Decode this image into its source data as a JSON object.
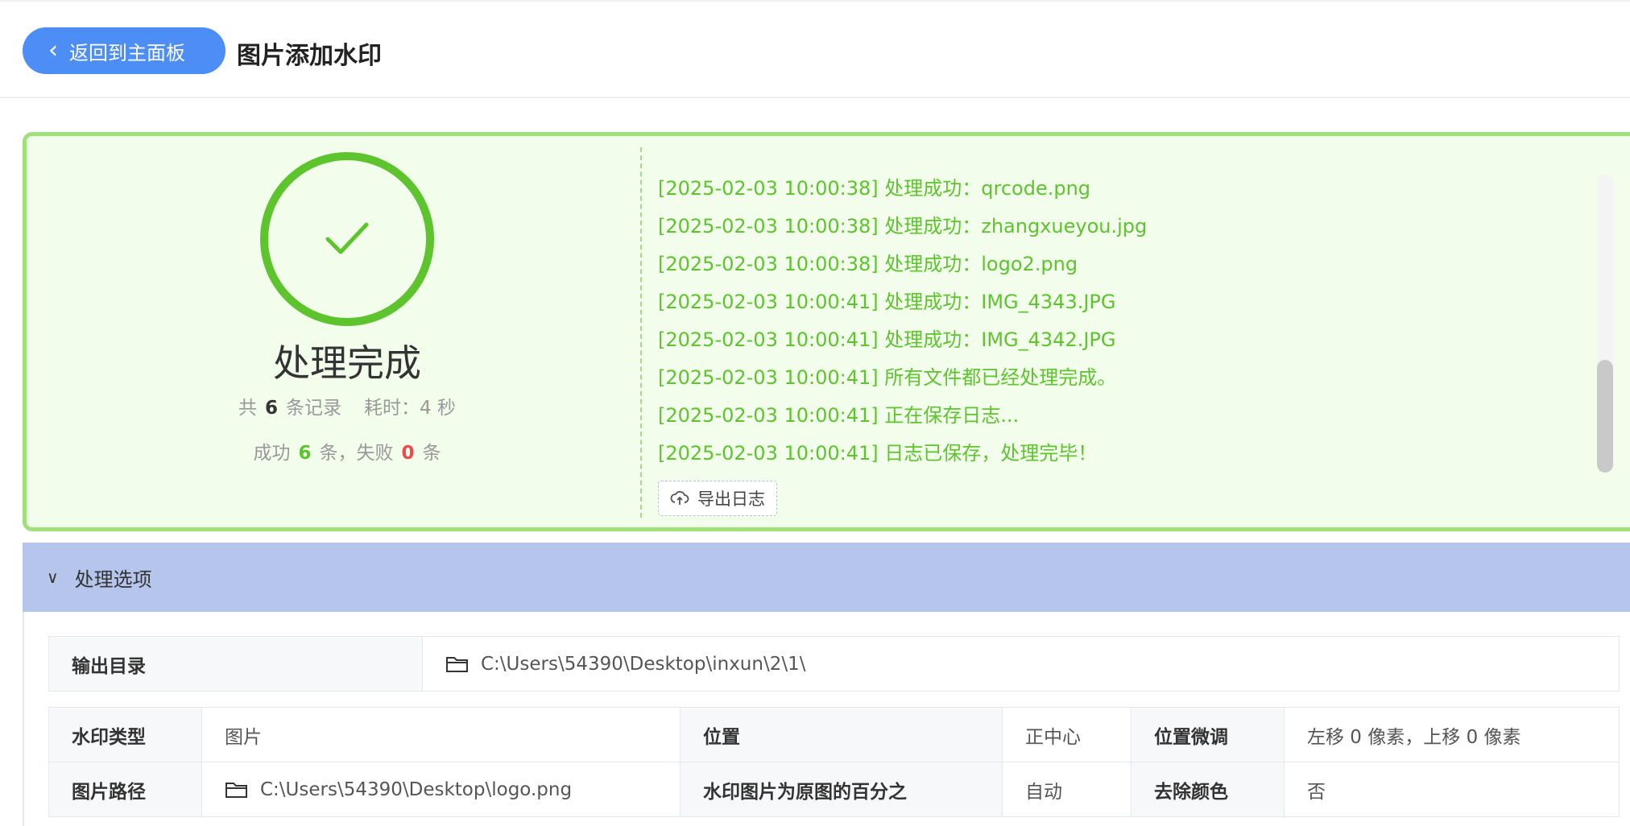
{
  "header": {
    "back_label": "返回到主面板",
    "title": "图片添加水印"
  },
  "result": {
    "status": "处理完成",
    "total_prefix": "共",
    "total_count": "6",
    "total_suffix": "条记录",
    "time_label": "耗时：4 秒",
    "success_prefix": "成功",
    "success_count": "6",
    "success_suffix": "条，失败",
    "fail_count": "0",
    "fail_suffix": "条",
    "export_label": "导出日志"
  },
  "log": [
    "[2025-02-03 10:00:38] 处理成功：qrcode.png",
    "[2025-02-03 10:00:38] 处理成功：zhangxueyou.jpg",
    "[2025-02-03 10:00:38] 处理成功：logo2.png",
    "[2025-02-03 10:00:41] 处理成功：IMG_4343.JPG",
    "[2025-02-03 10:00:41] 处理成功：IMG_4342.JPG",
    "[2025-02-03 10:00:41] 所有文件都已经处理完成。",
    "[2025-02-03 10:00:41] 正在保存日志...",
    "[2025-02-03 10:00:41] 日志已保存，处理完毕！"
  ],
  "options": {
    "title": "处理选项",
    "output_dir_label": "输出目录",
    "output_dir_value": "C:\\Users\\54390\\Desktop\\inxun\\2\\1\\",
    "rows": [
      [
        {
          "label": "水印类型",
          "value": "图片"
        },
        {
          "label": "位置",
          "value": "正中心"
        },
        {
          "label": "位置微调",
          "value": "左移 0 像素，上移 0 像素"
        }
      ],
      [
        {
          "label": "图片路径",
          "value": "C:\\Users\\54390\\Desktop\\logo.png"
        },
        {
          "label": "水印图片为原图的百分之",
          "value": "自动"
        },
        {
          "label": "去除颜色",
          "value": "否"
        }
      ]
    ]
  },
  "colors": {
    "accent": "#4d8ef6",
    "success": "#5ec42e",
    "fail": "#f04a4a",
    "panel_bg": "#f2fdeb",
    "options_header_bg": "#b5c5ec"
  }
}
